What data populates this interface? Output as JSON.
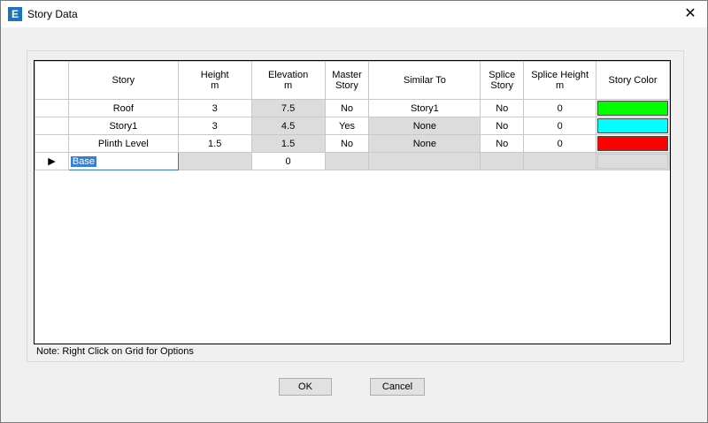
{
  "window": {
    "title": "Story Data",
    "app_icon_glyph": "E",
    "close_glyph": "✕"
  },
  "grid": {
    "columns": [
      {
        "label": "Story",
        "unit": ""
      },
      {
        "label": "Height",
        "unit": "m"
      },
      {
        "label": "Elevation",
        "unit": "m"
      },
      {
        "label": "Master Story",
        "unit": ""
      },
      {
        "label": "Similar To",
        "unit": ""
      },
      {
        "label": "Splice Story",
        "unit": ""
      },
      {
        "label": "Splice Height",
        "unit": "m"
      },
      {
        "label": "Story Color",
        "unit": ""
      }
    ],
    "rows": [
      {
        "story": "Roof",
        "height": "3",
        "elevation": "7.5",
        "master": "No",
        "similar": "Story1",
        "splice": "No",
        "splice_height": "0",
        "color": "#00ff00"
      },
      {
        "story": "Story1",
        "height": "3",
        "elevation": "4.5",
        "master": "Yes",
        "similar": "None",
        "splice": "No",
        "splice_height": "0",
        "color": "#00ffff"
      },
      {
        "story": "Plinth Level",
        "height": "1.5",
        "elevation": "1.5",
        "master": "No",
        "similar": "None",
        "splice": "No",
        "splice_height": "0",
        "color": "#ff0000"
      }
    ],
    "base_row": {
      "story": "Base",
      "elevation": "0",
      "indicator": "▶"
    }
  },
  "note": "Note:  Right Click on Grid for Options",
  "buttons": {
    "ok": "OK",
    "cancel": "Cancel"
  }
}
